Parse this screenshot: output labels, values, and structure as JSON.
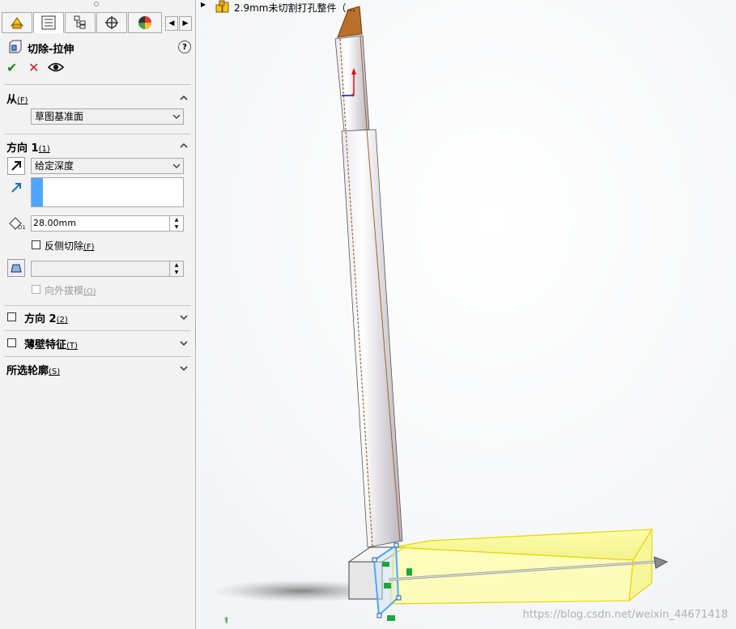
{
  "tree": {
    "label": "2.9mm未切割打孔整件（..."
  },
  "panel": {
    "title": "切除-拉伸",
    "help": "?",
    "from": {
      "title": "从",
      "hotkey": "(F)",
      "selected": "草图基准面"
    },
    "direction1": {
      "title": "方向 1",
      "hotkey": "(1)",
      "end_condition": "给定深度",
      "depth": "28.00mm",
      "flip_label": "反侧切除",
      "flip_hotkey": "(F)",
      "draft_label": "向外拔模",
      "draft_hotkey": "(O)"
    },
    "direction2": {
      "title": "方向 2",
      "hotkey": "(2)"
    },
    "thin": {
      "title": "薄壁特征",
      "hotkey": "(T)"
    },
    "contours": {
      "title": "所选轮廓",
      "hotkey": "(S)"
    }
  },
  "watermark": "https://blog.csdn.net/weixin_44671418",
  "colors": {
    "accent": "#4da6ff",
    "ok": "#1a8c1a",
    "cancel": "#d11b1b",
    "preview": "#ffff66"
  }
}
